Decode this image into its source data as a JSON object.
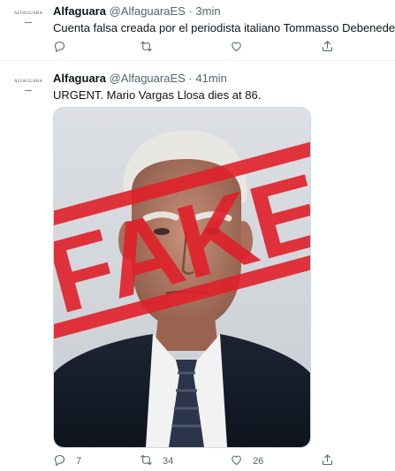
{
  "tweets": [
    {
      "avatar_text": "ALFAGUARA",
      "name": "Alfaguara",
      "handle": "@AlfaguaraES",
      "separator": "·",
      "time": "3min",
      "text": "Cuenta falsa creada por el periodista italiano Tommasso Debenedetti.",
      "reply_count": "",
      "retweet_count": "",
      "like_count": ""
    },
    {
      "avatar_text": "ALFAGUARA",
      "name": "Alfaguara",
      "handle": "@AlfaguaraES",
      "separator": "·",
      "time": "41min",
      "text": "URGENT. Mario Vargas Llosa dies at 86.",
      "stamp_text": "FAKE",
      "reply_count": "7",
      "retweet_count": "34",
      "like_count": "26"
    }
  ],
  "colors": {
    "text": "#0f1419",
    "secondary": "#536471",
    "stamp_red": "#e0202a",
    "divider": "#eff3f4"
  },
  "icons": [
    "reply-icon",
    "retweet-icon",
    "like-icon",
    "share-icon"
  ]
}
